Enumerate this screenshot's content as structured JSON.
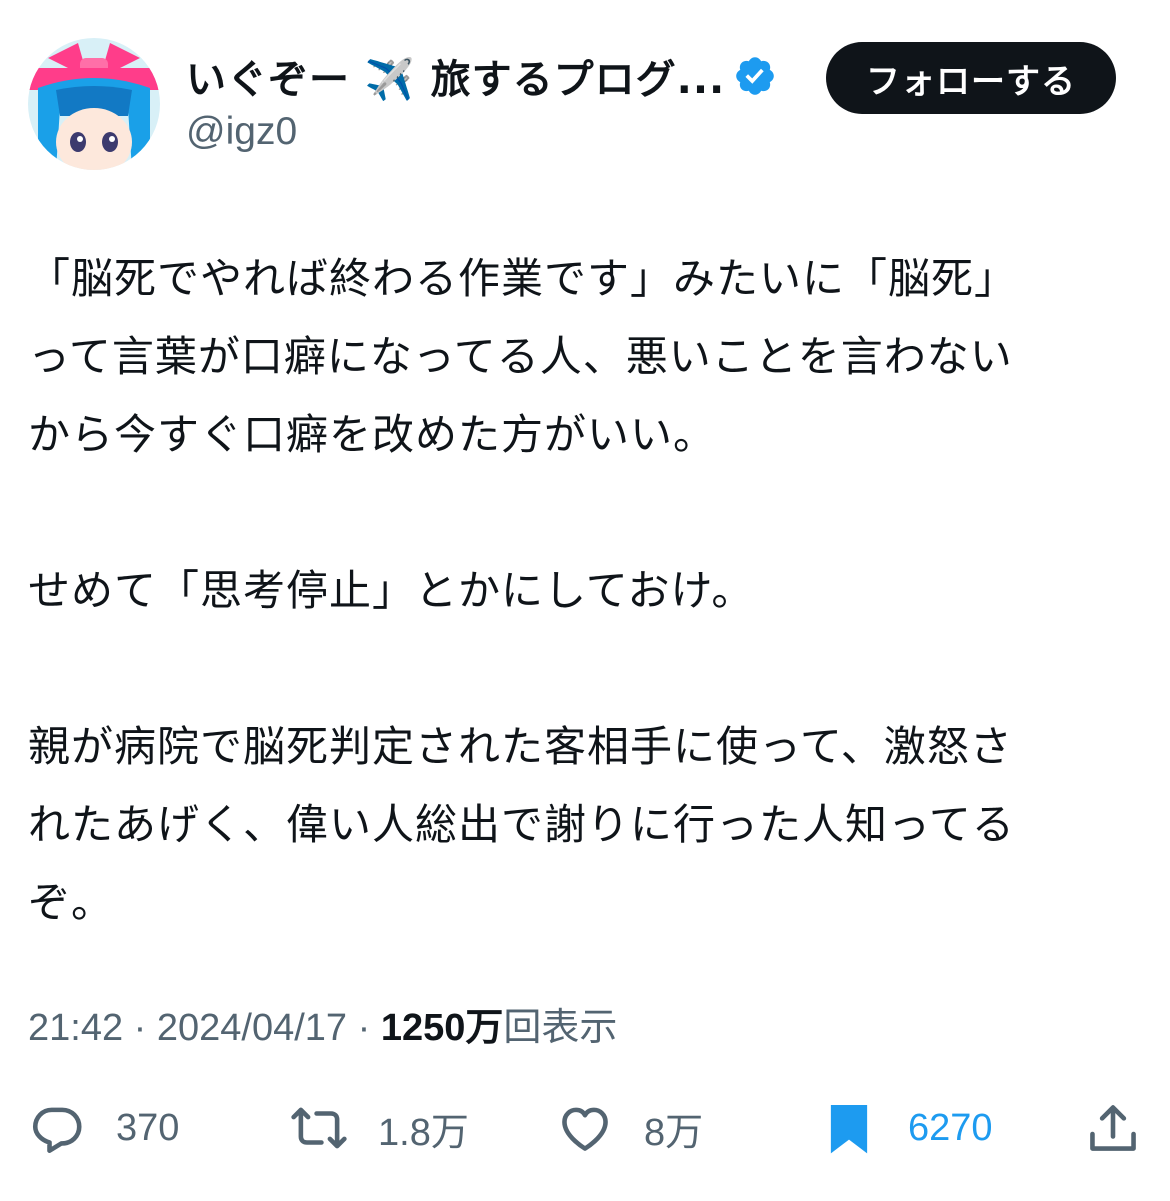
{
  "header": {
    "display_name": "いぐぞー ✈️ 旅するプログ...",
    "handle": "@igz0",
    "follow_label": "フォローする"
  },
  "tweet": {
    "text": "「脳死でやれば終わる作業です」みたいに「脳死」\nって言葉が口癖になってる人、悪いことを言わない\nから今すぐ口癖を改めた方がいい。\n\nせめて「思考停止」とかにしておけ。\n\n親が病院で脳死判定された客相手に使って、激怒さ\nれたあげく、偉い人総出で謝りに行った人知ってる\nぞ。"
  },
  "meta": {
    "time": "21:42",
    "date": "2024/04/17",
    "views_count": "1250万",
    "views_label": "回表示",
    "separator": "·"
  },
  "actions": {
    "reply_count": "370",
    "retweet_count": "1.8万",
    "like_count": "8万",
    "bookmark_count": "6270"
  },
  "colors": {
    "text": "#0f1419",
    "secondary": "#536471",
    "accent_blue": "#1d9bf0",
    "button_bg": "#0f1419"
  },
  "icons": {
    "reply": "reply-icon",
    "retweet": "retweet-icon",
    "like": "heart-icon",
    "bookmark": "bookmark-icon",
    "share": "share-icon",
    "verified": "verified-badge-icon"
  }
}
